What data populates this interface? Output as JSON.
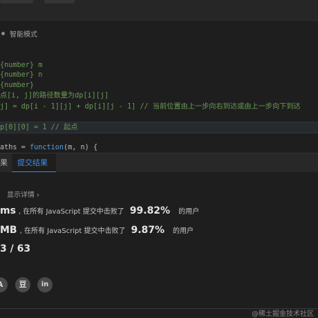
{
  "editor": {
    "mode_label": "智能模式",
    "lines": [
      {
        "text": "{number} m",
        "kind": "comment"
      },
      {
        "text": "{number} n",
        "kind": "comment"
      },
      {
        "text": "{number}",
        "kind": "comment"
      },
      {
        "text": "点[i, j]的路径数量为dp[i][j]",
        "kind": "comment"
      },
      {
        "text": "j] = dp[i - 1][j] + dp[i][j - 1] // 当前位置由上一步向右到达或由上一步向下到达",
        "kind": "comment"
      },
      {
        "text": "p[0][0] = 1 // 起点",
        "kind": "comment"
      }
    ],
    "last_line": {
      "prefix": "aths = ",
      "keyword": "function",
      "suffix": "(m, n) {"
    }
  },
  "tabs": [
    {
      "label": "果"
    },
    {
      "label": "提交结果"
    }
  ],
  "result": {
    "detail_link": "显示详情",
    "detail_chevron": "›",
    "runtime": {
      "value": "ms",
      "text_before": ", 在所有 JavaScript 提交中击败了",
      "percent": "99.82%",
      "text_after": "的用户"
    },
    "memory": {
      "value": "MB",
      "text_before": ", 在所有 JavaScript 提交中击败了",
      "percent": "9.87%",
      "text_after": "的用户"
    },
    "cases": "3 / 63"
  },
  "share": [
    {
      "glyph": "A",
      "icon": "share-a-icon"
    },
    {
      "glyph": "豆",
      "icon": "douban-icon"
    },
    {
      "glyph": "in",
      "icon": "linkedin-icon"
    }
  ],
  "watermark": "@稀土掘金技术社区",
  "colors": {
    "accent": "#3e8ee9",
    "comment": "#6a9955",
    "keyword": "#569cd6",
    "background": "#1e1e1e"
  }
}
